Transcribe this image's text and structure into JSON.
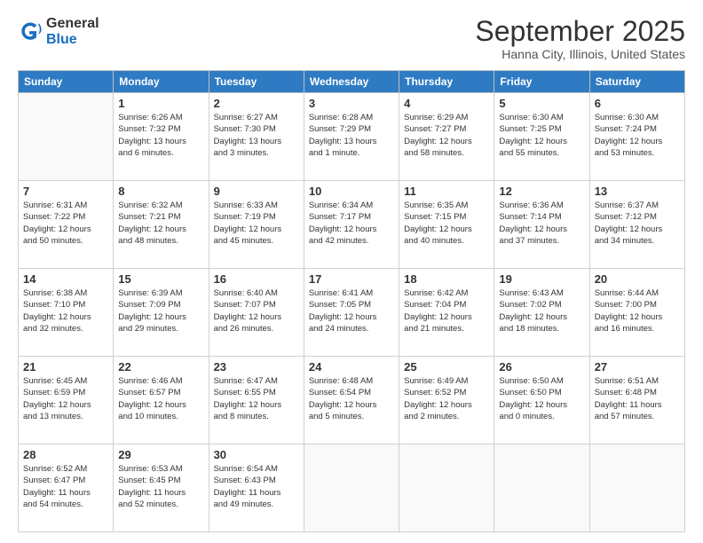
{
  "logo": {
    "general": "General",
    "blue": "Blue"
  },
  "header": {
    "month": "September 2025",
    "location": "Hanna City, Illinois, United States"
  },
  "days_of_week": [
    "Sunday",
    "Monday",
    "Tuesday",
    "Wednesday",
    "Thursday",
    "Friday",
    "Saturday"
  ],
  "weeks": [
    [
      {
        "day": "",
        "info": ""
      },
      {
        "day": "1",
        "info": "Sunrise: 6:26 AM\nSunset: 7:32 PM\nDaylight: 13 hours\nand 6 minutes."
      },
      {
        "day": "2",
        "info": "Sunrise: 6:27 AM\nSunset: 7:30 PM\nDaylight: 13 hours\nand 3 minutes."
      },
      {
        "day": "3",
        "info": "Sunrise: 6:28 AM\nSunset: 7:29 PM\nDaylight: 13 hours\nand 1 minute."
      },
      {
        "day": "4",
        "info": "Sunrise: 6:29 AM\nSunset: 7:27 PM\nDaylight: 12 hours\nand 58 minutes."
      },
      {
        "day": "5",
        "info": "Sunrise: 6:30 AM\nSunset: 7:25 PM\nDaylight: 12 hours\nand 55 minutes."
      },
      {
        "day": "6",
        "info": "Sunrise: 6:30 AM\nSunset: 7:24 PM\nDaylight: 12 hours\nand 53 minutes."
      }
    ],
    [
      {
        "day": "7",
        "info": "Sunrise: 6:31 AM\nSunset: 7:22 PM\nDaylight: 12 hours\nand 50 minutes."
      },
      {
        "day": "8",
        "info": "Sunrise: 6:32 AM\nSunset: 7:21 PM\nDaylight: 12 hours\nand 48 minutes."
      },
      {
        "day": "9",
        "info": "Sunrise: 6:33 AM\nSunset: 7:19 PM\nDaylight: 12 hours\nand 45 minutes."
      },
      {
        "day": "10",
        "info": "Sunrise: 6:34 AM\nSunset: 7:17 PM\nDaylight: 12 hours\nand 42 minutes."
      },
      {
        "day": "11",
        "info": "Sunrise: 6:35 AM\nSunset: 7:15 PM\nDaylight: 12 hours\nand 40 minutes."
      },
      {
        "day": "12",
        "info": "Sunrise: 6:36 AM\nSunset: 7:14 PM\nDaylight: 12 hours\nand 37 minutes."
      },
      {
        "day": "13",
        "info": "Sunrise: 6:37 AM\nSunset: 7:12 PM\nDaylight: 12 hours\nand 34 minutes."
      }
    ],
    [
      {
        "day": "14",
        "info": "Sunrise: 6:38 AM\nSunset: 7:10 PM\nDaylight: 12 hours\nand 32 minutes."
      },
      {
        "day": "15",
        "info": "Sunrise: 6:39 AM\nSunset: 7:09 PM\nDaylight: 12 hours\nand 29 minutes."
      },
      {
        "day": "16",
        "info": "Sunrise: 6:40 AM\nSunset: 7:07 PM\nDaylight: 12 hours\nand 26 minutes."
      },
      {
        "day": "17",
        "info": "Sunrise: 6:41 AM\nSunset: 7:05 PM\nDaylight: 12 hours\nand 24 minutes."
      },
      {
        "day": "18",
        "info": "Sunrise: 6:42 AM\nSunset: 7:04 PM\nDaylight: 12 hours\nand 21 minutes."
      },
      {
        "day": "19",
        "info": "Sunrise: 6:43 AM\nSunset: 7:02 PM\nDaylight: 12 hours\nand 18 minutes."
      },
      {
        "day": "20",
        "info": "Sunrise: 6:44 AM\nSunset: 7:00 PM\nDaylight: 12 hours\nand 16 minutes."
      }
    ],
    [
      {
        "day": "21",
        "info": "Sunrise: 6:45 AM\nSunset: 6:59 PM\nDaylight: 12 hours\nand 13 minutes."
      },
      {
        "day": "22",
        "info": "Sunrise: 6:46 AM\nSunset: 6:57 PM\nDaylight: 12 hours\nand 10 minutes."
      },
      {
        "day": "23",
        "info": "Sunrise: 6:47 AM\nSunset: 6:55 PM\nDaylight: 12 hours\nand 8 minutes."
      },
      {
        "day": "24",
        "info": "Sunrise: 6:48 AM\nSunset: 6:54 PM\nDaylight: 12 hours\nand 5 minutes."
      },
      {
        "day": "25",
        "info": "Sunrise: 6:49 AM\nSunset: 6:52 PM\nDaylight: 12 hours\nand 2 minutes."
      },
      {
        "day": "26",
        "info": "Sunrise: 6:50 AM\nSunset: 6:50 PM\nDaylight: 12 hours\nand 0 minutes."
      },
      {
        "day": "27",
        "info": "Sunrise: 6:51 AM\nSunset: 6:48 PM\nDaylight: 11 hours\nand 57 minutes."
      }
    ],
    [
      {
        "day": "28",
        "info": "Sunrise: 6:52 AM\nSunset: 6:47 PM\nDaylight: 11 hours\nand 54 minutes."
      },
      {
        "day": "29",
        "info": "Sunrise: 6:53 AM\nSunset: 6:45 PM\nDaylight: 11 hours\nand 52 minutes."
      },
      {
        "day": "30",
        "info": "Sunrise: 6:54 AM\nSunset: 6:43 PM\nDaylight: 11 hours\nand 49 minutes."
      },
      {
        "day": "",
        "info": ""
      },
      {
        "day": "",
        "info": ""
      },
      {
        "day": "",
        "info": ""
      },
      {
        "day": "",
        "info": ""
      }
    ]
  ]
}
